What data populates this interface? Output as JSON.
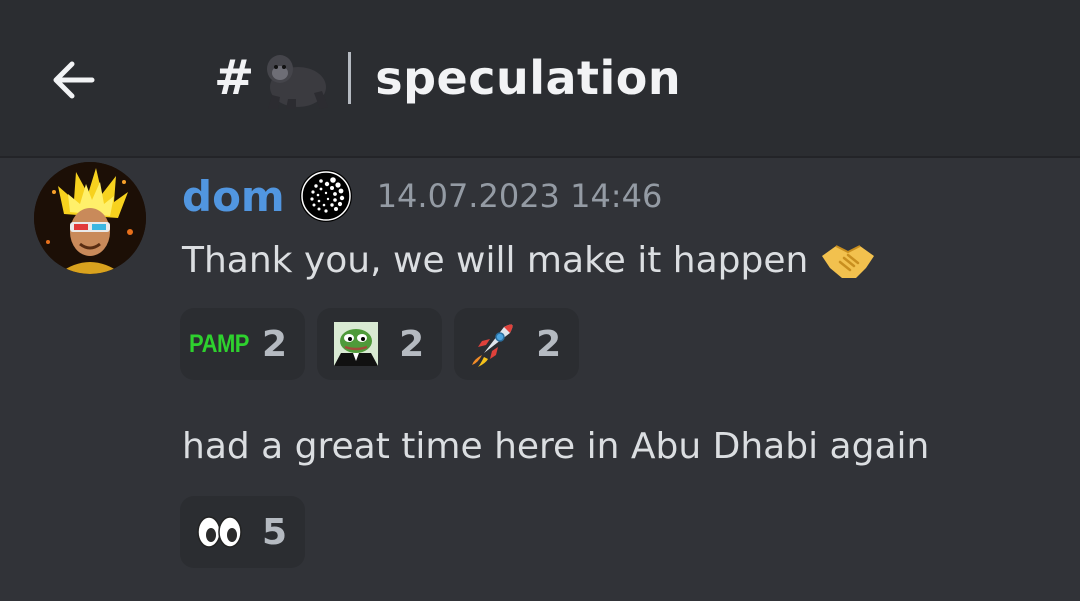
{
  "header": {
    "hash": "#",
    "channel_emoji": "gorilla-icon",
    "channel_name": "speculation"
  },
  "message": {
    "username": "dom",
    "username_color": "#5196e0",
    "timestamp": "14.07.2023 14:46",
    "text1": "Thank you, we will make it happen",
    "text2": "had a great time here in Abu Dhabi again"
  },
  "reactions1": [
    {
      "emoji": "pamp-emoji",
      "label": "PAMP",
      "count": "2"
    },
    {
      "emoji": "pepe-suit-emoji",
      "count": "2"
    },
    {
      "emoji": "rocket-emoji",
      "count": "2"
    }
  ],
  "reactions2": [
    {
      "emoji": "eyes-emoji",
      "count": "5"
    }
  ],
  "colors": {
    "background": "#313338",
    "header": "#2b2d31",
    "reaction_bg": "#2b2d31",
    "muted": "#949ba4"
  }
}
